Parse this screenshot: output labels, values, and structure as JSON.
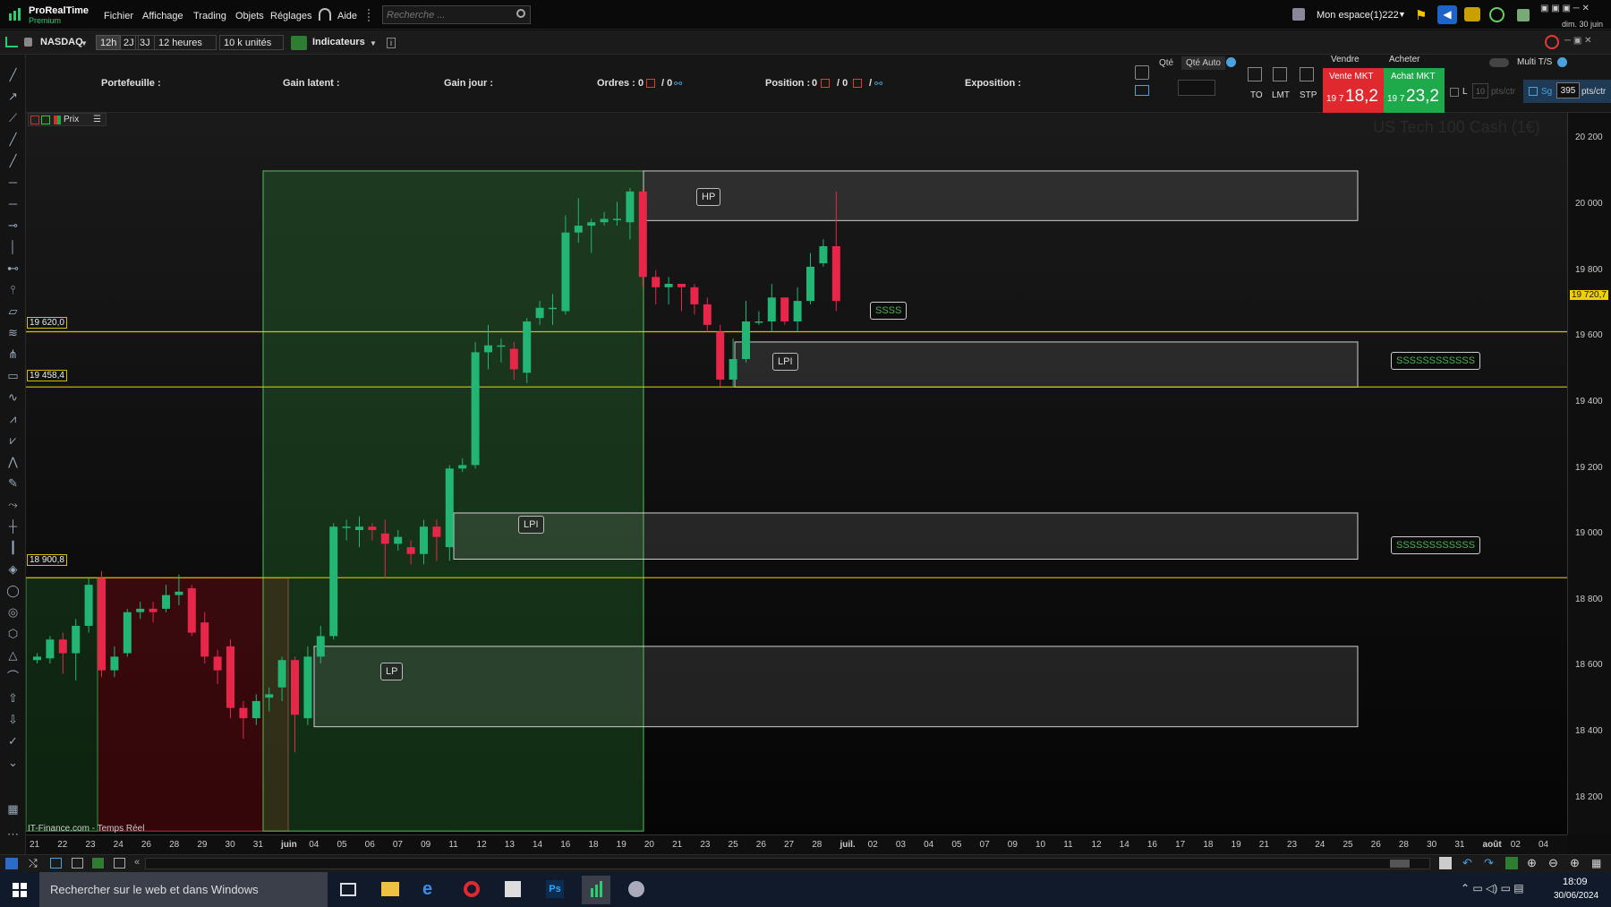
{
  "app": {
    "title": "ProRealTime",
    "edition": "Premium"
  },
  "menu": {
    "items": [
      "Fichier",
      "Affichage",
      "Trading",
      "Objets",
      "Réglages"
    ],
    "help": "Aide",
    "search_placeholder": "Recherche ..."
  },
  "workspace": {
    "label": "Mon espace(1)222"
  },
  "datetime_top": "dim. 30 juin",
  "toolbar": {
    "market": "NASDAQ",
    "periods": [
      "12h",
      "2J",
      "3J"
    ],
    "timeframe": "12 heures",
    "units": "10 k unités",
    "indicators": "Indicateurs"
  },
  "orderpanel": {
    "portfolio": "Portefeuille :",
    "latent": "Gain latent :",
    "day": "Gain jour :",
    "orders": "Ordres :",
    "orders_a": "0",
    "orders_b": "/ 0",
    "position": "Position :",
    "position_a": "0",
    "position_b": "/ 0",
    "position_c": "/",
    "exposure": "Exposition :",
    "qty": "Qté",
    "qty_auto": "Qté Auto",
    "order_types": [
      "TO",
      "LMT",
      "STP"
    ],
    "sell_header": "Vendre",
    "buy_header": "Acheter",
    "sell_label": "Vente MKT",
    "buy_label": "Achat MKT",
    "sell_small": "19 7",
    "sell_big": "18,2",
    "buy_small": "19 7",
    "buy_big": "23,2",
    "multi": "Multi T/S",
    "l": "L",
    "pts_input": "10",
    "pts_unit": "pts/ctr",
    "sg": "Sg",
    "sg_value": "395",
    "sg_unit": "pts/ctr"
  },
  "chart": {
    "instrument_watermark": "US Tech 100 Cash (1€)",
    "legend_prix": "Prix",
    "source": "IT-Finance.com - Temps Réel",
    "price_label_current": "19 720,7",
    "hlines": [
      {
        "value": 19620.0,
        "label": "19 620,0"
      },
      {
        "value": 19458.4,
        "label": "19 458,4"
      },
      {
        "value": 18900.8,
        "label": "18 900,8"
      }
    ],
    "zones": [
      {
        "label": "HP",
        "hi": 20090,
        "lo": 19945
      },
      {
        "label": "LPI",
        "hi": 19590,
        "lo": 19458
      },
      {
        "label": "LPI",
        "hi": 19090,
        "lo": 18955
      },
      {
        "label": "LP",
        "hi": 18700,
        "lo": 18465
      }
    ],
    "annotations": [
      {
        "text": "SSSS"
      },
      {
        "text": "SSSSSSSSSSSS"
      },
      {
        "text": "SSSSSSSSSSSS"
      }
    ],
    "y_ticks": [
      "20 200",
      "20 000",
      "19 800",
      "19 600",
      "19 400",
      "19 200",
      "19 000",
      "18 800",
      "18 600",
      "18 400",
      "18 200"
    ],
    "x_ticks": [
      "21",
      "22",
      "23",
      "24",
      "26",
      "28",
      "29",
      "30",
      "31",
      "juin",
      "04",
      "05",
      "06",
      "07",
      "09",
      "11",
      "12",
      "13",
      "14",
      "16",
      "18",
      "19",
      "20",
      "21",
      "23",
      "25",
      "26",
      "27",
      "28",
      "juil.",
      "02",
      "03",
      "04",
      "05",
      "07",
      "09",
      "10",
      "11",
      "12",
      "14",
      "16",
      "17",
      "18",
      "19",
      "21",
      "23",
      "24",
      "25",
      "26",
      "28",
      "30",
      "31",
      "août",
      "02",
      "04"
    ]
  },
  "chart_data": {
    "type": "candlestick",
    "ylim": [
      18150,
      20260
    ],
    "candles": [
      [
        18660,
        18670,
        18650,
        18680
      ],
      [
        18665,
        18720,
        18650,
        18730
      ],
      [
        18720,
        18680,
        18620,
        18740
      ],
      [
        18680,
        18760,
        18600,
        18780
      ],
      [
        18760,
        18880,
        18740,
        18900
      ],
      [
        18900,
        18630,
        18610,
        18920
      ],
      [
        18630,
        18670,
        18610,
        18700
      ],
      [
        18680,
        18800,
        18670,
        18810
      ],
      [
        18800,
        18810,
        18780,
        18830
      ],
      [
        18810,
        18800,
        18770,
        18830
      ],
      [
        18810,
        18850,
        18800,
        18880
      ],
      [
        18850,
        18860,
        18820,
        18910
      ],
      [
        18870,
        18740,
        18730,
        18880
      ],
      [
        18770,
        18670,
        18650,
        18800
      ],
      [
        18670,
        18630,
        18590,
        18690
      ],
      [
        18700,
        18520,
        18490,
        18720
      ],
      [
        18520,
        18490,
        18430,
        18540
      ],
      [
        18490,
        18540,
        18470,
        18560
      ],
      [
        18550,
        18560,
        18510,
        18580
      ],
      [
        18580,
        18660,
        18540,
        18670
      ],
      [
        18660,
        18500,
        18390,
        18670
      ],
      [
        18490,
        18670,
        18470,
        18700
      ],
      [
        18670,
        18730,
        18650,
        18760
      ],
      [
        18730,
        19050,
        18720,
        19060
      ],
      [
        19050,
        19050,
        19010,
        19070
      ],
      [
        19040,
        19050,
        18990,
        19080
      ],
      [
        19050,
        19040,
        19010,
        19060
      ],
      [
        19030,
        19000,
        18900,
        19070
      ],
      [
        19000,
        19020,
        18980,
        19040
      ],
      [
        18990,
        18970,
        18940,
        19010
      ],
      [
        18970,
        19050,
        18940,
        19070
      ],
      [
        19050,
        19020,
        18950,
        19070
      ],
      [
        18990,
        19220,
        18950,
        19230
      ],
      [
        19220,
        19230,
        19210,
        19250
      ],
      [
        19230,
        19560,
        19220,
        19590
      ],
      [
        19560,
        19580,
        19510,
        19640
      ],
      [
        19580,
        19580,
        19530,
        19600
      ],
      [
        19570,
        19510,
        19480,
        19590
      ],
      [
        19500,
        19650,
        19470,
        19660
      ],
      [
        19660,
        19690,
        19640,
        19710
      ],
      [
        19690,
        19690,
        19640,
        19730
      ],
      [
        19680,
        19910,
        19670,
        19960
      ],
      [
        19910,
        19930,
        19880,
        20010
      ],
      [
        19930,
        19940,
        19850,
        19950
      ],
      [
        19940,
        19950,
        19930,
        19970
      ],
      [
        19950,
        19950,
        19930,
        20000
      ],
      [
        19940,
        20030,
        19890,
        20040
      ],
      [
        20030,
        19780,
        19750,
        20040
      ],
      [
        19780,
        19750,
        19700,
        19800
      ],
      [
        19750,
        19760,
        19700,
        19780
      ],
      [
        19760,
        19750,
        19680,
        19760
      ],
      [
        19750,
        19700,
        19670,
        19760
      ],
      [
        19700,
        19640,
        19620,
        19720
      ],
      [
        19620,
        19480,
        19460,
        19640
      ],
      [
        19480,
        19540,
        19460,
        19600
      ],
      [
        19540,
        19650,
        19530,
        19710
      ],
      [
        19650,
        19650,
        19640,
        19680
      ],
      [
        19650,
        19720,
        19620,
        19760
      ],
      [
        19720,
        19650,
        19640,
        19720
      ],
      [
        19650,
        19710,
        19620,
        19750
      ],
      [
        19710,
        19810,
        19700,
        19850
      ],
      [
        19820,
        19870,
        19810,
        19890
      ],
      [
        19870,
        19710,
        19680,
        20030
      ]
    ]
  },
  "taskbar": {
    "search": "Rechercher sur le web et dans Windows",
    "time": "18:09",
    "date": "30/06/2024"
  }
}
